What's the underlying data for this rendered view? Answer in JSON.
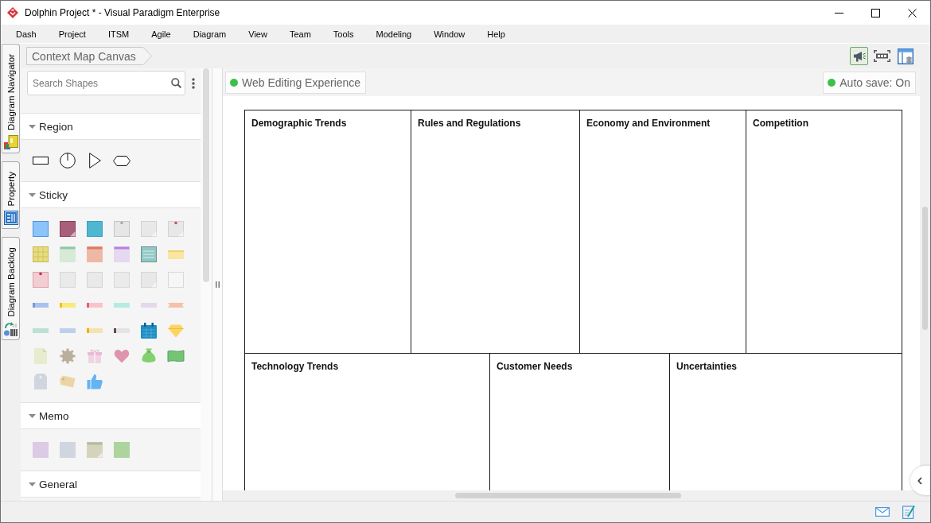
{
  "window": {
    "title": "Dolphin Project * - Visual Paradigm Enterprise"
  },
  "menu": [
    "Dash",
    "Project",
    "ITSM",
    "Agile",
    "Diagram",
    "View",
    "Team",
    "Tools",
    "Modeling",
    "Window",
    "Help"
  ],
  "side_tabs": [
    {
      "label": "Diagram Navigator"
    },
    {
      "label": "Property"
    },
    {
      "label": "Diagram Backlog"
    }
  ],
  "breadcrumb": "Context Map Canvas",
  "toolbar": [
    {
      "kind": "megaphone",
      "selected": true
    },
    {
      "kind": "fit",
      "selected": false
    },
    {
      "kind": "layers",
      "selected": false
    }
  ],
  "shape_panel": {
    "search": {
      "placeholder": "Search Shapes"
    },
    "sections": [
      {
        "title": "Region",
        "expanded": true
      },
      {
        "title": "Sticky",
        "expanded": true
      },
      {
        "title": "Memo",
        "expanded": true
      },
      {
        "title": "General",
        "expanded": true
      }
    ]
  },
  "canvas": {
    "web_editing": {
      "label": "Web Editing Experience",
      "active": true
    },
    "auto_save": {
      "label": "Auto save: On",
      "active": true
    }
  },
  "diagram": {
    "rows": [
      [
        {
          "title": "Demographic Trends"
        },
        {
          "title": "Rules and Regulations"
        },
        {
          "title": "Economy and Environment"
        },
        {
          "title": "Competition"
        }
      ],
      [
        {
          "title": "Technology Trends"
        },
        {
          "title": "Customer Needs"
        },
        {
          "title": "Uncertainties"
        }
      ]
    ]
  }
}
